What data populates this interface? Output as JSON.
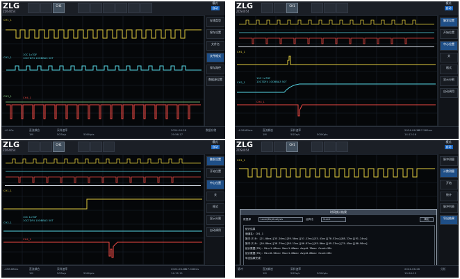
{
  "app": {
    "logo": "ZLG",
    "model": "ZDS4054"
  },
  "top": {
    "active_tab": "CH1",
    "ch_info": "Vt: CH1",
    "mode_label": "模式",
    "mode_button": "自动"
  },
  "quadrants": [
    {
      "side": [
        "存储类型",
        "保存设置",
        "文件名",
        "文件格式",
        "保存路径",
        "数据源设置"
      ],
      "bottom": {
        "left": "+0.00s",
        "chan1": "直流耦合",
        "chan1b": "1M",
        "chan2": "采样速率",
        "chan2b": "5GSa/s",
        "mem": "500Kpts",
        "right": "2024-06-28",
        "time": "19:56:17",
        "status": "数据存储"
      },
      "labels": {
        "ch1": "CH1_1",
        "ch2": "CH2_1",
        "ch3": "CH3_1",
        "dec": "10C 1x7DF",
        "dec2": "10C7DF4 10OBBA3 50T",
        "ch4": "CH4_1",
        "ch4b": "R0C"
      }
    },
    {
      "side": [
        "触发设置",
        "开始位置",
        "中心位置",
        "关",
        "格式",
        "显示分割",
        "自动调用"
      ],
      "bottom": {
        "left": "-4.56·60ms",
        "chan1": "直流耦合",
        "chan1b": "1M",
        "chan2": "采样速率",
        "chan2b": "5GSa/s",
        "mem": "500Kpts",
        "right": "2024-06-28",
        "time": "14:12:16",
        "status": "+17.560ms"
      },
      "labels": {
        "ch1": "CH1_1",
        "ch2": "CH2_1",
        "ch3": "CH3_1",
        "dec": "10C 1x7DF",
        "dec2": "10C7DF4 10OBBA3 50T",
        "ch4": "CH4_1",
        "ch4b": "R0C"
      }
    },
    {
      "side": [
        "触发设置",
        "开始位置",
        "中心位置",
        "关",
        "格式",
        "显示分割",
        "自动调用"
      ],
      "bottom": {
        "left": "-498.68ms",
        "chan1": "直流耦合",
        "chan1b": "1M",
        "chan2": "采样速率",
        "chan2b": "5GSa/s",
        "mem": "500Kpts",
        "right": "2024-06-28",
        "time": "14:12:11",
        "status": "+17.048ms"
      },
      "labels": {
        "ch1": "CH1_1",
        "ch2": "CH2_1",
        "ch3": "CH3_1",
        "dec": "10C 1x7DF",
        "dec2": "10C7DF4 10OBBA3 50T",
        "ch4": "CH4_1",
        "ch4b": "R0C"
      }
    },
    {
      "side": [
        "脉冲测量",
        "计数测量",
        "开始",
        "统计",
        "脉冲列表",
        "导出结果"
      ],
      "bottom": {
        "left": "脉冲",
        "chan1": "直流耦合",
        "chan1b": "1M",
        "chan2": "采样速率",
        "chan2b": "5GSa/s",
        "mem": "500Kpts",
        "right": "2024-06-28",
        "time": "19:56:15",
        "status": "分析"
      },
      "labels": {
        "ch1": "CH1_1"
      }
    }
  ],
  "dialog": {
    "title": "时间统计结果",
    "filter_label": "数据源",
    "filter_value": "Local/Dc/Analysis",
    "op_label": "运算法",
    "op_value": "Sum1",
    "button": "确定",
    "result_header": "统计结果",
    "result_rows": [
      "通道名: CH1_1",
      "脉冲(T)B: [21.00ns][35.20ns][39.50ns][51.13ns][53.41ns][70.52ns][88.27ns][91.24ns]",
      "脉冲(T)B: [10.80ns][38.79ns][58.13ns][60.87ns][63.86ns][69.23ns][75.45ns][80.90ns]",
      "统计数据(TB): Min<1.00ns> Max<1.00ms> Avg<0.70ms> Count<28>",
      "统计数据(TB): Min<0.50ns> Max<1.00ms> Avg<0.60ms> Count<26>",
      "导出结果完成！"
    ]
  }
}
